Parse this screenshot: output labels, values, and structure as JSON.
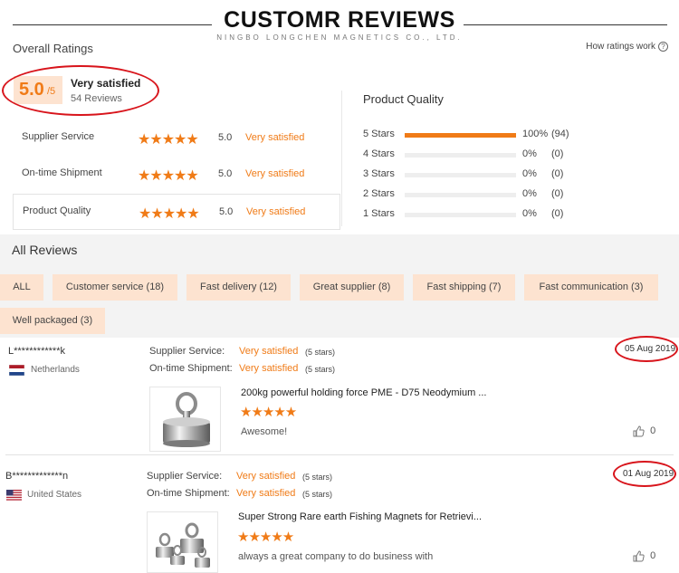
{
  "banner": {
    "title": "CUSTOMR REVIEWS",
    "subtitle": "NINGBO LONGCHEN MAGNETICS CO., LTD."
  },
  "overall": {
    "label": "Overall Ratings",
    "how_link": "How ratings work",
    "score": "5.0",
    "out_of": "/5",
    "verdict": "Very satisfied",
    "review_count": "54 Reviews"
  },
  "metrics": [
    {
      "label": "Supplier Service",
      "stars": "★★★★★",
      "score": "5.0",
      "verdict": "Very satisfied"
    },
    {
      "label": "On-time Shipment",
      "stars": "★★★★★",
      "score": "5.0",
      "verdict": "Very satisfied"
    },
    {
      "label": "Product Quality",
      "stars": "★★★★★",
      "score": "5.0",
      "verdict": "Very satisfied"
    }
  ],
  "product_quality": {
    "title": "Product Quality",
    "distribution": [
      {
        "label": "5  Stars",
        "fraction": 1.0,
        "pct": "100%",
        "count": "(94)"
      },
      {
        "label": "4  Stars",
        "fraction": 0.0,
        "pct": "0%",
        "count": "(0)"
      },
      {
        "label": "3  Stars",
        "fraction": 0.0,
        "pct": "0%",
        "count": "(0)"
      },
      {
        "label": "2  Stars",
        "fraction": 0.0,
        "pct": "0%",
        "count": "(0)"
      },
      {
        "label": "1  Stars",
        "fraction": 0.0,
        "pct": "0%",
        "count": "(0)"
      }
    ]
  },
  "all_reviews": {
    "title": "All Reviews",
    "filters": [
      "ALL",
      "Customer service (18)",
      "Fast delivery (12)",
      "Great supplier (8)",
      "Fast shipping (7)",
      "Fast communication (3)",
      "Well packaged (3)"
    ]
  },
  "reviews": [
    {
      "name": "L************k",
      "country": "Netherlands",
      "service_label": "Supplier Service:",
      "service_verdict": "Very satisfied",
      "service_stars": "(5 stars)",
      "shipment_label": "On-time Shipment:",
      "shipment_verdict": "Very satisfied",
      "shipment_stars": "(5 stars)",
      "date": "05 Aug 2019",
      "product": "200kg powerful holding force PME - D75 Neodymium ...",
      "stars": "★★★★★",
      "comment": "Awesome!",
      "likes": "0"
    },
    {
      "name": "B*************n",
      "country": "United States",
      "service_label": "Supplier Service:",
      "service_verdict": "Very satisfied",
      "service_stars": "(5 stars)",
      "shipment_label": "On-time Shipment:",
      "shipment_verdict": "Very satisfied",
      "shipment_stars": "(5 stars)",
      "date": "01 Aug 2019",
      "product": "Super Strong Rare earth Fishing Magnets for Retrievi...",
      "stars": "★★★★★",
      "comment": "always a great company to do business with",
      "likes": "0"
    }
  ],
  "colors": {
    "accent": "#f07b17",
    "chip_bg": "#fde3d0",
    "annotation": "#d8141b"
  }
}
